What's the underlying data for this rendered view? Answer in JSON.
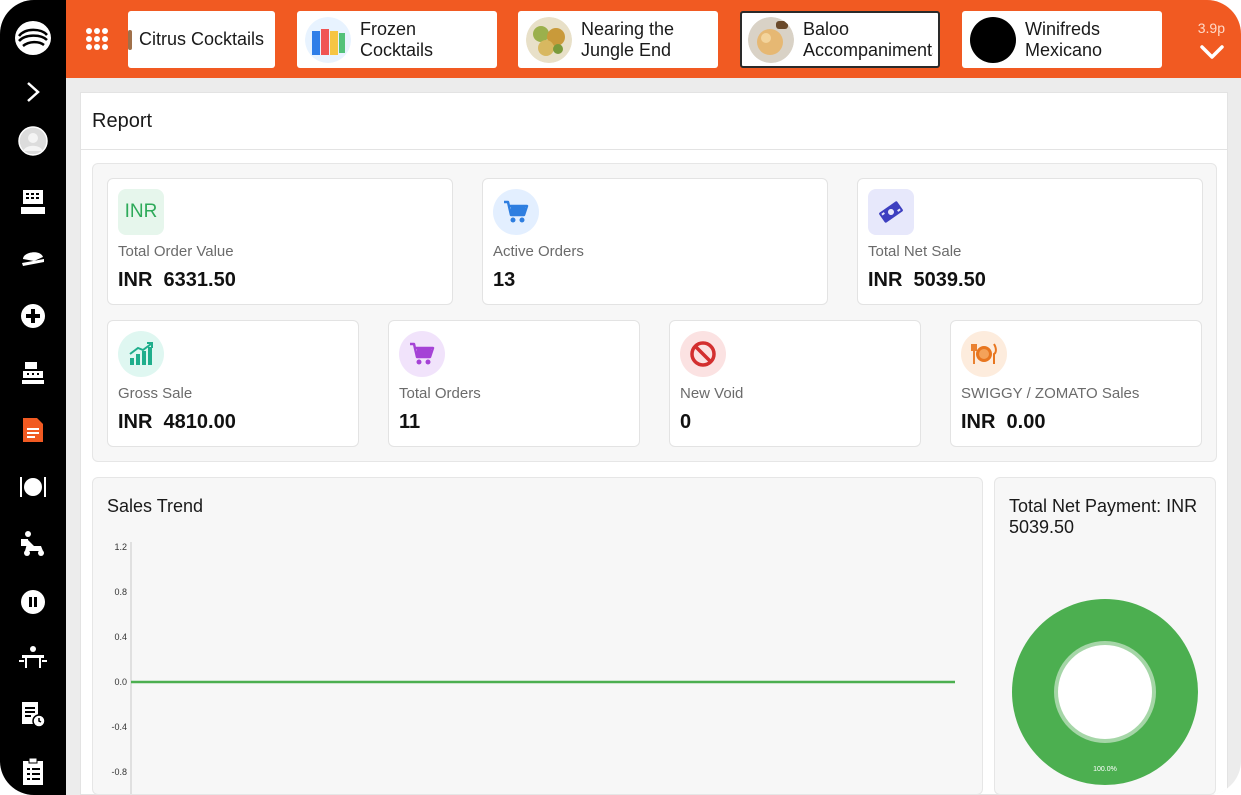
{
  "topbar": {
    "categories": [
      {
        "label": "Citrus Cocktails",
        "thumb": "citrus-thumb"
      },
      {
        "label": "Frozen Cocktails",
        "thumb": "frozen-cocktails-thumb"
      },
      {
        "label": "Nearing the Jungle End",
        "thumb": "jungle-end-thumb"
      },
      {
        "label": "Baloo Accompaniments (Indian",
        "thumb": "baloo-thumb"
      },
      {
        "label": "Winifreds Mexicano",
        "thumb": "winifreds-thumb"
      }
    ],
    "version": "3.9p"
  },
  "sidebar": {
    "items": [
      "logo-icon",
      "expand-icon",
      "profile-icon",
      "pos-terminal-icon",
      "takeaway-icon",
      "add-icon",
      "cash-register-icon",
      "report-icon",
      "dine-in-icon",
      "delivery-icon",
      "pause-icon",
      "table-icon",
      "order-history-icon",
      "checklist-icon"
    ],
    "active": "report-icon"
  },
  "report": {
    "title": "Report",
    "cards": {
      "total_order_value": {
        "icon_text": "INR",
        "label": "Total Order Value",
        "value": "INR  6331.50"
      },
      "active_orders": {
        "label": "Active Orders",
        "value": "13"
      },
      "total_net_sale": {
        "label": "Total Net Sale",
        "value": "INR  5039.50"
      },
      "gross_sale": {
        "label": "Gross Sale",
        "value": "INR  4810.00"
      },
      "total_orders": {
        "label": "Total Orders",
        "value": "11"
      },
      "new_void": {
        "label": "New Void",
        "value": "0"
      },
      "swiggy_zomato": {
        "label": "SWIGGY / ZOMATO Sales",
        "value": "INR  0.00"
      }
    }
  },
  "sales_trend": {
    "title": "Sales Trend"
  },
  "payment": {
    "title_prefix": "Total Net Payment: INR",
    "title_value": "5039.50"
  },
  "colors": {
    "accent": "#f15a22",
    "sidebar": "#000000",
    "trend_line": "#4caf50",
    "donut": "#4caf50"
  },
  "chart_data": [
    {
      "type": "line",
      "title": "Sales Trend",
      "xlabel": "",
      "ylabel": "",
      "ylim": [
        -0.8,
        1.2
      ],
      "yticks": [
        "1.2",
        "0.8",
        "0.4",
        "0.0",
        "-0.4",
        "-0.8"
      ],
      "series": [
        {
          "values": [
            0,
            0
          ]
        }
      ],
      "grid": false
    },
    {
      "type": "pie",
      "title": "Total Net Payment: INR 5039.50",
      "slices": [
        {
          "value": 100.0,
          "color": "#4caf50"
        }
      ],
      "slice_labels": [
        "100.0%"
      ],
      "donut": true
    }
  ]
}
